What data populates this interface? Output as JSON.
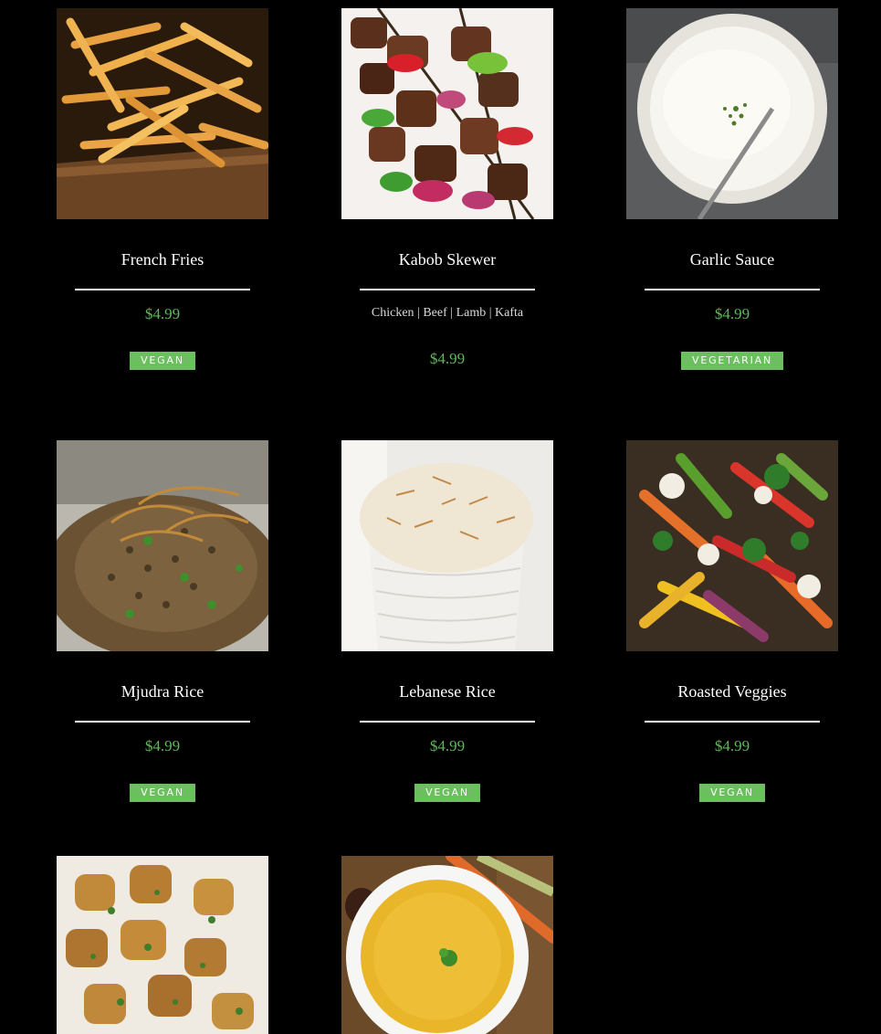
{
  "menu": {
    "items": [
      {
        "name": "French Fries",
        "price": "$4.99",
        "tag": "VEGAN",
        "image": "french-fries-photo"
      },
      {
        "name": "Kabob Skewer",
        "options": "Chicken | Beef | Lamb | Kafta",
        "price": "$4.99",
        "image": "kabob-skewer-photo"
      },
      {
        "name": "Garlic Sauce",
        "price": "$4.99",
        "tag": "VEGETARIAN",
        "image": "garlic-sauce-photo"
      },
      {
        "name": "Mjudra Rice",
        "price": "$4.99",
        "tag": "VEGAN",
        "image": "mjudra-rice-photo"
      },
      {
        "name": "Lebanese Rice",
        "price": "$4.99",
        "tag": "VEGAN",
        "image": "lebanese-rice-photo"
      },
      {
        "name": "Roasted Veggies",
        "price": "$4.99",
        "tag": "VEGAN",
        "image": "roasted-veggies-photo"
      },
      {
        "image": "potatoes-photo"
      },
      {
        "image": "lentil-soup-photo"
      }
    ]
  },
  "colors": {
    "background": "#000000",
    "price": "#5fb85a",
    "badge": "#6cbf5e",
    "title": "#ffffff"
  }
}
